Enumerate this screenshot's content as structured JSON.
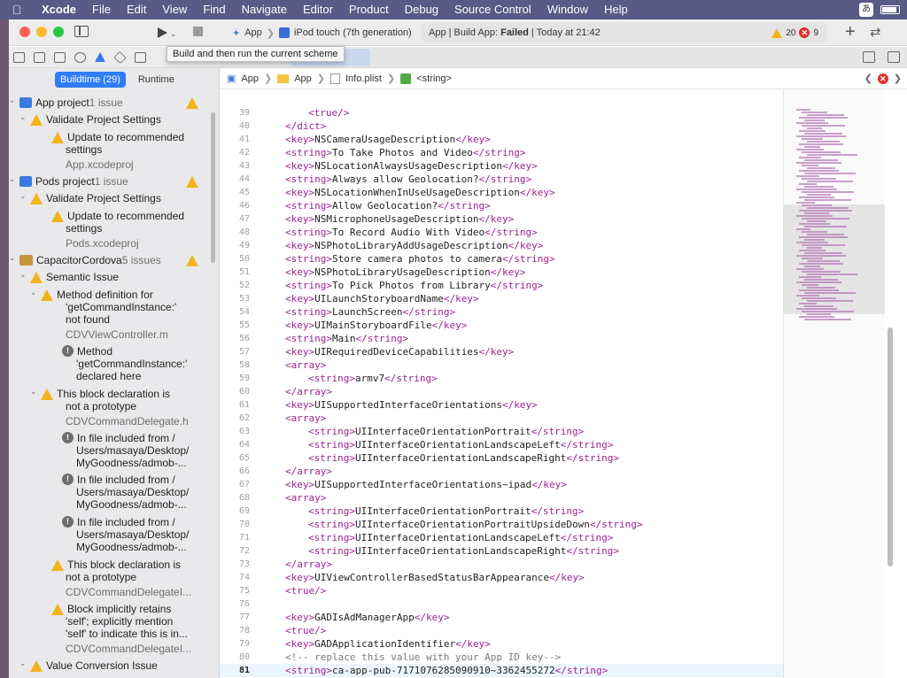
{
  "menubar": {
    "app": "Xcode",
    "items": [
      "File",
      "Edit",
      "View",
      "Find",
      "Navigate",
      "Editor",
      "Product",
      "Debug",
      "Source Control",
      "Window",
      "Help"
    ],
    "input_mode": "あ"
  },
  "toolbar": {
    "scheme": "App",
    "device": "iPod touch (7th generation)",
    "status_prefix": "App | Build App:",
    "status_result": "Failed",
    "status_time": "| Today at 21:42",
    "warning_count": "20",
    "error_count": "9"
  },
  "tooltip": "Build and then run the current scheme",
  "tab": {
    "label": "plist"
  },
  "navigator": {
    "segments": {
      "buildtime": "Buildtime (29)",
      "runtime": "Runtime"
    },
    "rows": [
      {
        "text": "App project",
        "sub": " 1 issue"
      },
      {
        "text": "Validate Project Settings"
      },
      {
        "text": "Update to recommended"
      },
      {
        "text": "settings"
      },
      {
        "text": "App.xcodeproj"
      },
      {
        "text": "Pods project",
        "sub": " 1 issue"
      },
      {
        "text": "Validate Project Settings"
      },
      {
        "text": "Update to recommended"
      },
      {
        "text": "settings"
      },
      {
        "text": "Pods.xcodeproj"
      },
      {
        "text": "CapacitorCordova",
        "sub": " 5 issues"
      },
      {
        "text": "Semantic Issue"
      },
      {
        "text": "Method definition for"
      },
      {
        "text": "'getCommandInstance:'"
      },
      {
        "text": "not found"
      },
      {
        "text": "CDVViewController.m"
      },
      {
        "text": "Method"
      },
      {
        "text": "'getCommandInstance:'"
      },
      {
        "text": "declared here"
      },
      {
        "text": "This block declaration is"
      },
      {
        "text": "not a prototype"
      },
      {
        "text": "CDVCommandDelegate.h"
      },
      {
        "text": "In file included from /"
      },
      {
        "text": "Users/masaya/Desktop/"
      },
      {
        "text": "MyGoodness/admob-..."
      },
      {
        "text": "In file included from /"
      },
      {
        "text": "Users/masaya/Desktop/"
      },
      {
        "text": "MyGoodness/admob-..."
      },
      {
        "text": "In file included from /"
      },
      {
        "text": "Users/masaya/Desktop/"
      },
      {
        "text": "MyGoodness/admob-..."
      },
      {
        "text": "This block declaration is"
      },
      {
        "text": "not a prototype"
      },
      {
        "text": "CDVCommandDelegateI..."
      },
      {
        "text": "Block implicitly retains"
      },
      {
        "text": "'self'; explicitly mention"
      },
      {
        "text": "'self' to indicate this is in..."
      },
      {
        "text": "CDVCommandDelegateI..."
      },
      {
        "text": "Value Conversion Issue"
      }
    ]
  },
  "jumpbar": {
    "crumb1": "App",
    "crumb2": "App",
    "crumb3": "Info.plist",
    "crumb4": "<string>"
  },
  "editor": {
    "current_line": 81,
    "lines": [
      {
        "n": "39",
        "i": 2,
        "t": "<true/>"
      },
      {
        "n": "40",
        "i": 1,
        "t": "</dict>"
      },
      {
        "n": "41",
        "i": 1,
        "t": "<key>NSCameraUsageDescription</key>"
      },
      {
        "n": "42",
        "i": 1,
        "t": "<string>To Take Photos and Video</string>"
      },
      {
        "n": "43",
        "i": 1,
        "t": "<key>NSLocationAlwaysUsageDescription</key>"
      },
      {
        "n": "44",
        "i": 1,
        "t": "<string>Always allow Geolocation?</string>"
      },
      {
        "n": "45",
        "i": 1,
        "t": "<key>NSLocationWhenInUseUsageDescription</key>"
      },
      {
        "n": "46",
        "i": 1,
        "t": "<string>Allow Geolocation?</string>"
      },
      {
        "n": "47",
        "i": 1,
        "t": "<key>NSMicrophoneUsageDescription</key>"
      },
      {
        "n": "48",
        "i": 1,
        "t": "<string>To Record Audio With Video</string>"
      },
      {
        "n": "49",
        "i": 1,
        "t": "<key>NSPhotoLibraryAddUsageDescription</key>"
      },
      {
        "n": "50",
        "i": 1,
        "t": "<string>Store camera photos to camera</string>"
      },
      {
        "n": "51",
        "i": 1,
        "t": "<key>NSPhotoLibraryUsageDescription</key>"
      },
      {
        "n": "52",
        "i": 1,
        "t": "<string>To Pick Photos from Library</string>"
      },
      {
        "n": "53",
        "i": 1,
        "t": "<key>UILaunchStoryboardName</key>"
      },
      {
        "n": "54",
        "i": 1,
        "t": "<string>LaunchScreen</string>"
      },
      {
        "n": "55",
        "i": 1,
        "t": "<key>UIMainStoryboardFile</key>"
      },
      {
        "n": "56",
        "i": 1,
        "t": "<string>Main</string>"
      },
      {
        "n": "57",
        "i": 1,
        "t": "<key>UIRequiredDeviceCapabilities</key>"
      },
      {
        "n": "58",
        "i": 1,
        "t": "<array>"
      },
      {
        "n": "59",
        "i": 2,
        "t": "<string>armv7</string>"
      },
      {
        "n": "60",
        "i": 1,
        "t": "</array>"
      },
      {
        "n": "61",
        "i": 1,
        "t": "<key>UISupportedInterfaceOrientations</key>"
      },
      {
        "n": "62",
        "i": 1,
        "t": "<array>"
      },
      {
        "n": "63",
        "i": 2,
        "t": "<string>UIInterfaceOrientationPortrait</string>"
      },
      {
        "n": "64",
        "i": 2,
        "t": "<string>UIInterfaceOrientationLandscapeLeft</string>"
      },
      {
        "n": "65",
        "i": 2,
        "t": "<string>UIInterfaceOrientationLandscapeRight</string>"
      },
      {
        "n": "66",
        "i": 1,
        "t": "</array>"
      },
      {
        "n": "67",
        "i": 1,
        "t": "<key>UISupportedInterfaceOrientations~ipad</key>"
      },
      {
        "n": "68",
        "i": 1,
        "t": "<array>"
      },
      {
        "n": "69",
        "i": 2,
        "t": "<string>UIInterfaceOrientationPortrait</string>"
      },
      {
        "n": "70",
        "i": 2,
        "t": "<string>UIInterfaceOrientationPortraitUpsideDown</string>"
      },
      {
        "n": "71",
        "i": 2,
        "t": "<string>UIInterfaceOrientationLandscapeLeft</string>"
      },
      {
        "n": "72",
        "i": 2,
        "t": "<string>UIInterfaceOrientationLandscapeRight</string>"
      },
      {
        "n": "73",
        "i": 1,
        "t": "</array>"
      },
      {
        "n": "74",
        "i": 1,
        "t": "<key>UIViewControllerBasedStatusBarAppearance</key>"
      },
      {
        "n": "75",
        "i": 1,
        "t": "<true/>"
      },
      {
        "n": "76",
        "i": 0,
        "t": ""
      },
      {
        "n": "77",
        "i": 1,
        "t": "<key>GADIsAdManagerApp</key>"
      },
      {
        "n": "78",
        "i": 1,
        "t": "<true/>"
      },
      {
        "n": "79",
        "i": 1,
        "t": "<key>GADApplicationIdentifier</key>"
      },
      {
        "n": "80",
        "i": 1,
        "t": "<!-- replace this value with your App ID key-->"
      },
      {
        "n": "81",
        "i": 1,
        "t": "<string>ca-app-pub-7171076285090910~3362455272</string>"
      },
      {
        "n": "82",
        "i": 0,
        "t": ""
      }
    ]
  },
  "colors": {
    "accent": "#2f7cf6",
    "warning": "#f2b31b",
    "error": "#e0302d",
    "xml_tag": "#9b2393"
  }
}
